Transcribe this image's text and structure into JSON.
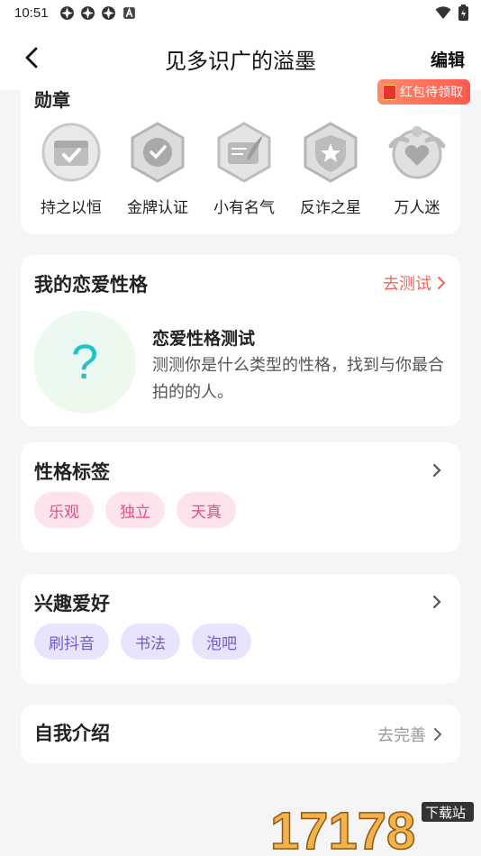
{
  "status": {
    "time": "10:51"
  },
  "nav": {
    "title": "见多识广的溢墨",
    "edit": "编辑",
    "redpacket": "红包待领取"
  },
  "badges": {
    "title": "勋章",
    "items": [
      {
        "label": "持之以恒",
        "icon": "calendar-check-badge-icon"
      },
      {
        "label": "金牌认证",
        "icon": "gold-certified-badge-icon"
      },
      {
        "label": "小有名气",
        "icon": "feather-note-badge-icon"
      },
      {
        "label": "反诈之星",
        "icon": "shield-star-badge-icon"
      },
      {
        "label": "万人迷",
        "icon": "heart-crest-badge-icon"
      }
    ]
  },
  "love": {
    "title": "我的恋爱性格",
    "action": "去测试",
    "test_title": "恋爱性格测试",
    "test_desc": "测测你是什么类型的性格，找到与你最合拍的的人。",
    "q_mark": "?"
  },
  "tags": {
    "title": "性格标签",
    "items": [
      "乐观",
      "独立",
      "天真"
    ]
  },
  "hobby": {
    "title": "兴趣爱好",
    "items": [
      "刷抖音",
      "书法",
      "泡吧"
    ]
  },
  "intro": {
    "title": "自我介绍",
    "action": "去完善"
  },
  "watermark": {
    "text": "17178",
    "sub": "下载站"
  },
  "colors": {
    "accent_red": "#f2655b",
    "tag_pink": "#ef4b7c",
    "tag_purple": "#6e5bd6",
    "q_teal": "#22c2c9"
  }
}
